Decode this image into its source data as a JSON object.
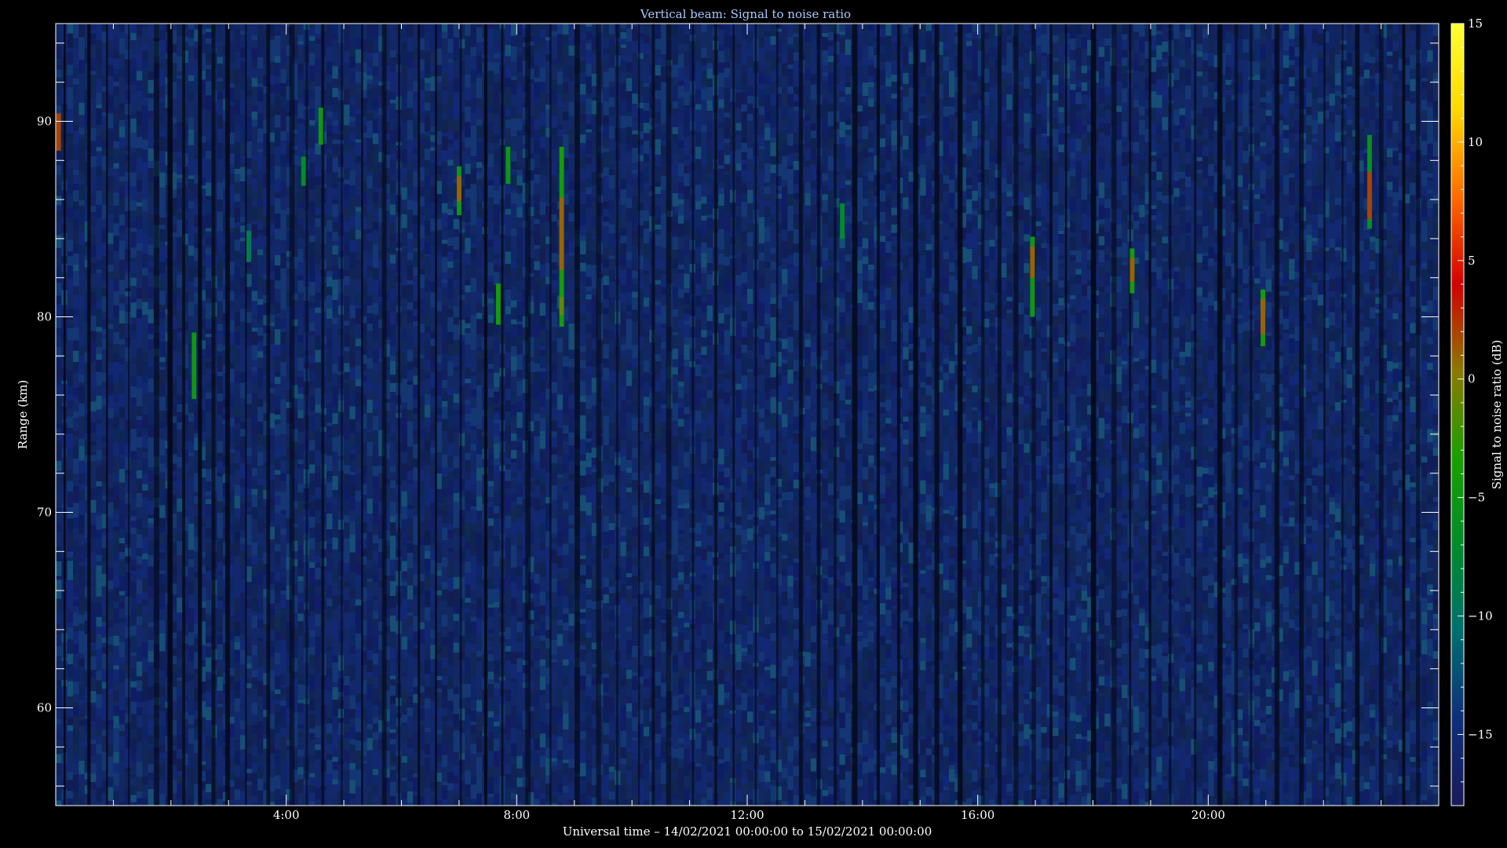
{
  "chart_data": {
    "type": "heatmap",
    "title": "Vertical beam: Signal to noise ratio",
    "xlabel": "Universal time – 14/02/2021 00:00:00 to 15/02/2021 00:00:00",
    "ylabel": "Range (km)",
    "colorbar_label": "Signal to noise ratio (dB)",
    "x_unit": "hours UT",
    "xlim": [
      0,
      24
    ],
    "ylim": [
      55,
      95
    ],
    "clim": [
      -18,
      15
    ],
    "x_ticks": [
      4,
      8,
      12,
      16,
      20
    ],
    "x_tick_labels": [
      "4:00",
      "8:00",
      "12:00",
      "16:00",
      "20:00"
    ],
    "y_ticks": [
      60,
      70,
      80,
      90
    ],
    "y_tick_labels": [
      "60",
      "70",
      "80",
      "90"
    ],
    "colorbar_ticks": [
      15,
      10,
      5,
      0,
      -5,
      -10,
      -15
    ],
    "colorbar_tick_labels": [
      "15",
      "10",
      "5",
      "0",
      "−5",
      "−10",
      "−15"
    ],
    "background_db": -15,
    "colormap": [
      "#1a1a5a",
      "#0e2f7a",
      "#006f6f",
      "#008c2a",
      "#1aa000",
      "#8a7a00",
      "#d20000",
      "#ff6a00",
      "#ffd800",
      "#ffff30"
    ],
    "echoes": [
      {
        "t": 0.05,
        "r0": 88.5,
        "r1": 90.4,
        "db": 2
      },
      {
        "t": 2.4,
        "r0": 75.8,
        "r1": 79.2,
        "db": -5
      },
      {
        "t": 3.35,
        "r0": 82.8,
        "r1": 84.4,
        "db": -9
      },
      {
        "t": 4.3,
        "r0": 86.7,
        "r1": 88.2,
        "db": -7
      },
      {
        "t": 4.6,
        "r0": 88.8,
        "r1": 90.7,
        "db": -5
      },
      {
        "t": 7.0,
        "r0": 85.2,
        "r1": 87.7,
        "db": -5
      },
      {
        "t": 7.0,
        "r0": 85.9,
        "r1": 87.2,
        "db": 1
      },
      {
        "t": 7.68,
        "r0": 79.6,
        "r1": 81.7,
        "db": -4
      },
      {
        "t": 7.85,
        "r0": 86.8,
        "r1": 88.7,
        "db": -5
      },
      {
        "t": 8.78,
        "r0": 79.5,
        "r1": 88.7,
        "db": -4
      },
      {
        "t": 8.78,
        "r0": 82.4,
        "r1": 86.1,
        "db": 1
      },
      {
        "t": 8.78,
        "r0": 80.1,
        "r1": 81.0,
        "db": -1
      },
      {
        "t": 13.65,
        "r0": 84.0,
        "r1": 85.8,
        "db": -7
      },
      {
        "t": 16.95,
        "r0": 80.0,
        "r1": 84.1,
        "db": -5
      },
      {
        "t": 16.95,
        "r0": 82.0,
        "r1": 83.6,
        "db": 1
      },
      {
        "t": 18.68,
        "r0": 81.2,
        "r1": 83.5,
        "db": -4
      },
      {
        "t": 18.68,
        "r0": 81.8,
        "r1": 83.0,
        "db": 1
      },
      {
        "t": 20.95,
        "r0": 78.5,
        "r1": 81.4,
        "db": -4
      },
      {
        "t": 20.95,
        "r0": 79.1,
        "r1": 80.9,
        "db": 1
      },
      {
        "t": 22.8,
        "r0": 84.5,
        "r1": 89.3,
        "db": -6
      },
      {
        "t": 22.8,
        "r0": 85.0,
        "r1": 87.4,
        "db": 2
      }
    ]
  }
}
